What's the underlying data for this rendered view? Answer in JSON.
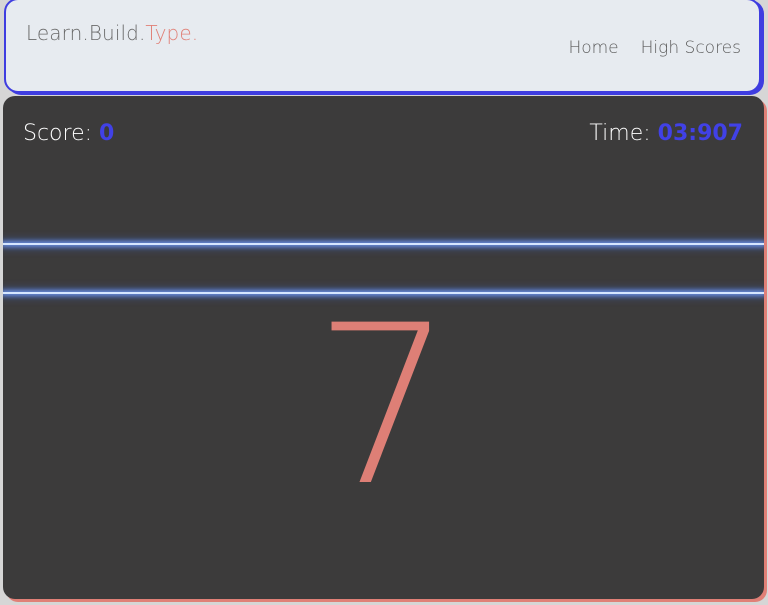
{
  "nav": {
    "brand_learn": "Learn.",
    "brand_build": "Build.",
    "brand_type": "Type.",
    "links": [
      "Home",
      "High Scores"
    ]
  },
  "game": {
    "score_label": "Score:",
    "score_value": "0",
    "time_label": "Time:",
    "time_value": "03:907",
    "current_char": "7"
  },
  "colors": {
    "accent_blue": "#4141e6",
    "accent_salmon": "#de7f76",
    "panel_bg": "#3c3b3b",
    "nav_bg": "#e7ebf0"
  }
}
